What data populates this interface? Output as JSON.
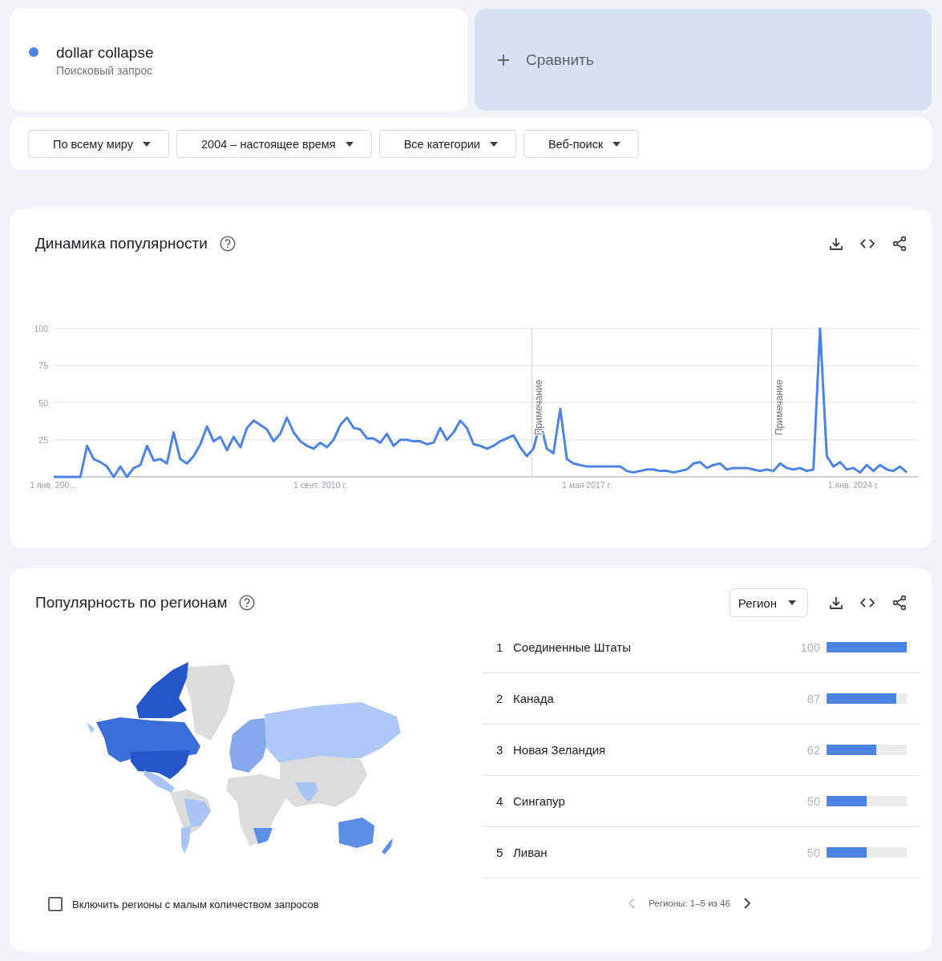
{
  "search_terms": [
    {
      "term": "dollar collapse",
      "subtitle": "Поисковый запрос",
      "color": "#4d84e3"
    }
  ],
  "compare": {
    "label": "Сравнить"
  },
  "filters": [
    "По всему миру",
    "2004 – настоящее время",
    "Все категории",
    "Веб-поиск"
  ],
  "interest_over_time": {
    "title": "Динамика популярности",
    "chart_data": {
      "type": "line",
      "grid": true,
      "series": [
        {
          "color": "#4d84e3",
          "values": [
            0,
            0,
            0,
            0,
            0,
            21,
            12,
            10,
            7,
            0,
            7,
            0,
            6,
            8,
            21,
            11,
            12,
            9,
            30,
            12,
            9,
            14,
            22,
            34,
            24,
            27,
            18,
            27,
            20,
            33,
            38,
            35,
            32,
            24,
            29,
            40,
            30,
            24,
            21,
            19,
            23,
            20,
            25,
            35,
            40,
            33,
            32,
            26,
            26,
            23,
            29,
            21,
            25,
            25,
            24,
            24,
            22,
            23,
            33,
            25,
            30,
            38,
            33,
            22,
            21,
            19,
            21,
            24,
            26,
            28,
            20,
            14,
            19,
            37,
            19,
            16,
            46,
            12,
            9,
            8,
            7,
            7,
            7,
            7,
            7,
            7,
            4,
            3,
            4,
            5,
            5,
            4,
            4,
            3,
            4,
            5,
            9,
            10,
            6,
            8,
            9,
            5,
            6,
            6,
            6,
            5,
            4,
            5,
            4,
            9,
            6,
            5,
            6,
            4,
            5,
            100,
            14,
            7,
            10,
            5,
            6,
            3,
            8,
            4,
            8,
            5,
            4,
            7,
            3
          ]
        }
      ],
      "ylim": [
        0,
        100
      ],
      "yticks": [
        25,
        50,
        75,
        100
      ],
      "categories": [
        "1 янв. 200…",
        null,
        null,
        null,
        null,
        null,
        null,
        null,
        null,
        null,
        null,
        null,
        null,
        null,
        null,
        null,
        null,
        null,
        null,
        null,
        null,
        null,
        null,
        null,
        null,
        null,
        null,
        null,
        null,
        null,
        null,
        null,
        null,
        null,
        null,
        null,
        null,
        null,
        null,
        null,
        "1 сент. 2010 г.",
        null,
        null,
        null,
        null,
        null,
        null,
        null,
        null,
        null,
        null,
        null,
        null,
        null,
        null,
        null,
        null,
        null,
        null,
        null,
        null,
        null,
        null,
        null,
        null,
        null,
        null,
        null,
        null,
        null,
        null,
        null,
        null,
        null,
        null,
        null,
        null,
        null,
        null,
        null,
        "1 мая 2017 г.",
        null,
        null,
        null,
        null,
        null,
        null,
        null,
        null,
        null,
        null,
        null,
        null,
        null,
        null,
        null,
        null,
        null,
        null,
        null,
        null,
        null,
        null,
        null,
        null,
        null,
        null,
        null,
        null,
        null,
        null,
        null,
        null,
        null,
        null,
        null,
        null,
        null,
        null,
        null,
        "1 янв. 2024 г.",
        null,
        null,
        null,
        null,
        null,
        null,
        null,
        null
      ],
      "annotations": [
        "Примечание",
        "Примечание"
      ]
    }
  },
  "interest_by_region": {
    "title": "Популярность по регионам",
    "resolution": "Регион",
    "rows": [
      {
        "rank": "1",
        "name": "Соединенные Штаты",
        "value": "100",
        "level": 1
      },
      {
        "rank": "2",
        "name": "Канада",
        "value": "87",
        "level": 0.87
      },
      {
        "rank": "3",
        "name": "Новая Зеландия",
        "value": "62",
        "level": 0.62
      },
      {
        "rank": "4",
        "name": "Сингапур",
        "value": "50",
        "level": 0.5
      },
      {
        "rank": "5",
        "name": "Ливан",
        "value": "50",
        "level": 0.5
      }
    ],
    "pagination": {
      "label": "Регионы: 1–5 из 46",
      "prev_disabled": true,
      "next_disabled": false
    },
    "low_volume": {
      "label": "Включить регионы с малым количеством запросов",
      "checked": false
    }
  }
}
